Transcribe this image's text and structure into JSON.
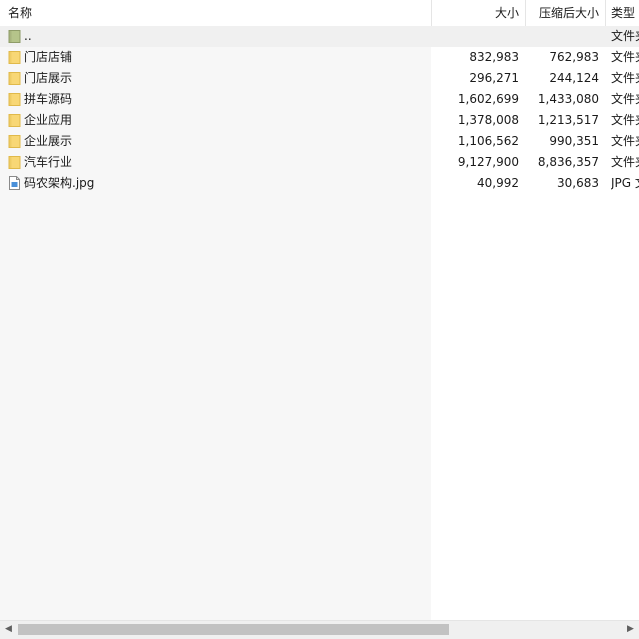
{
  "columns": {
    "name": "名称",
    "size": "大小",
    "compressed": "压缩后大小",
    "type": "类型"
  },
  "sort_indicator": "^",
  "rows": [
    {
      "name": "..",
      "size": "",
      "compressed": "",
      "type": "文件夹",
      "icon": "parent-folder-icon"
    },
    {
      "name": "门店店铺",
      "size": "832,983",
      "compressed": "762,983",
      "type": "文件夹",
      "icon": "folder-icon"
    },
    {
      "name": "门店展示",
      "size": "296,271",
      "compressed": "244,124",
      "type": "文件夹",
      "icon": "folder-icon"
    },
    {
      "name": "拼车源码",
      "size": "1,602,699",
      "compressed": "1,433,080",
      "type": "文件夹",
      "icon": "folder-icon"
    },
    {
      "name": "企业应用",
      "size": "1,378,008",
      "compressed": "1,213,517",
      "type": "文件夹",
      "icon": "folder-icon"
    },
    {
      "name": "企业展示",
      "size": "1,106,562",
      "compressed": "990,351",
      "type": "文件夹",
      "icon": "folder-icon"
    },
    {
      "name": "汽车行业",
      "size": "9,127,900",
      "compressed": "8,836,357",
      "type": "文件夹",
      "icon": "folder-icon"
    },
    {
      "name": "码农架构.jpg",
      "size": "40,992",
      "compressed": "30,683",
      "type": "JPG 文件",
      "icon": "image-file-icon"
    }
  ],
  "colors": {
    "folder": "#f8d775",
    "folder_edge": "#e0b94a",
    "parent_folder": "#b5c48a",
    "scroll_thumb": "#c2c2c2"
  }
}
